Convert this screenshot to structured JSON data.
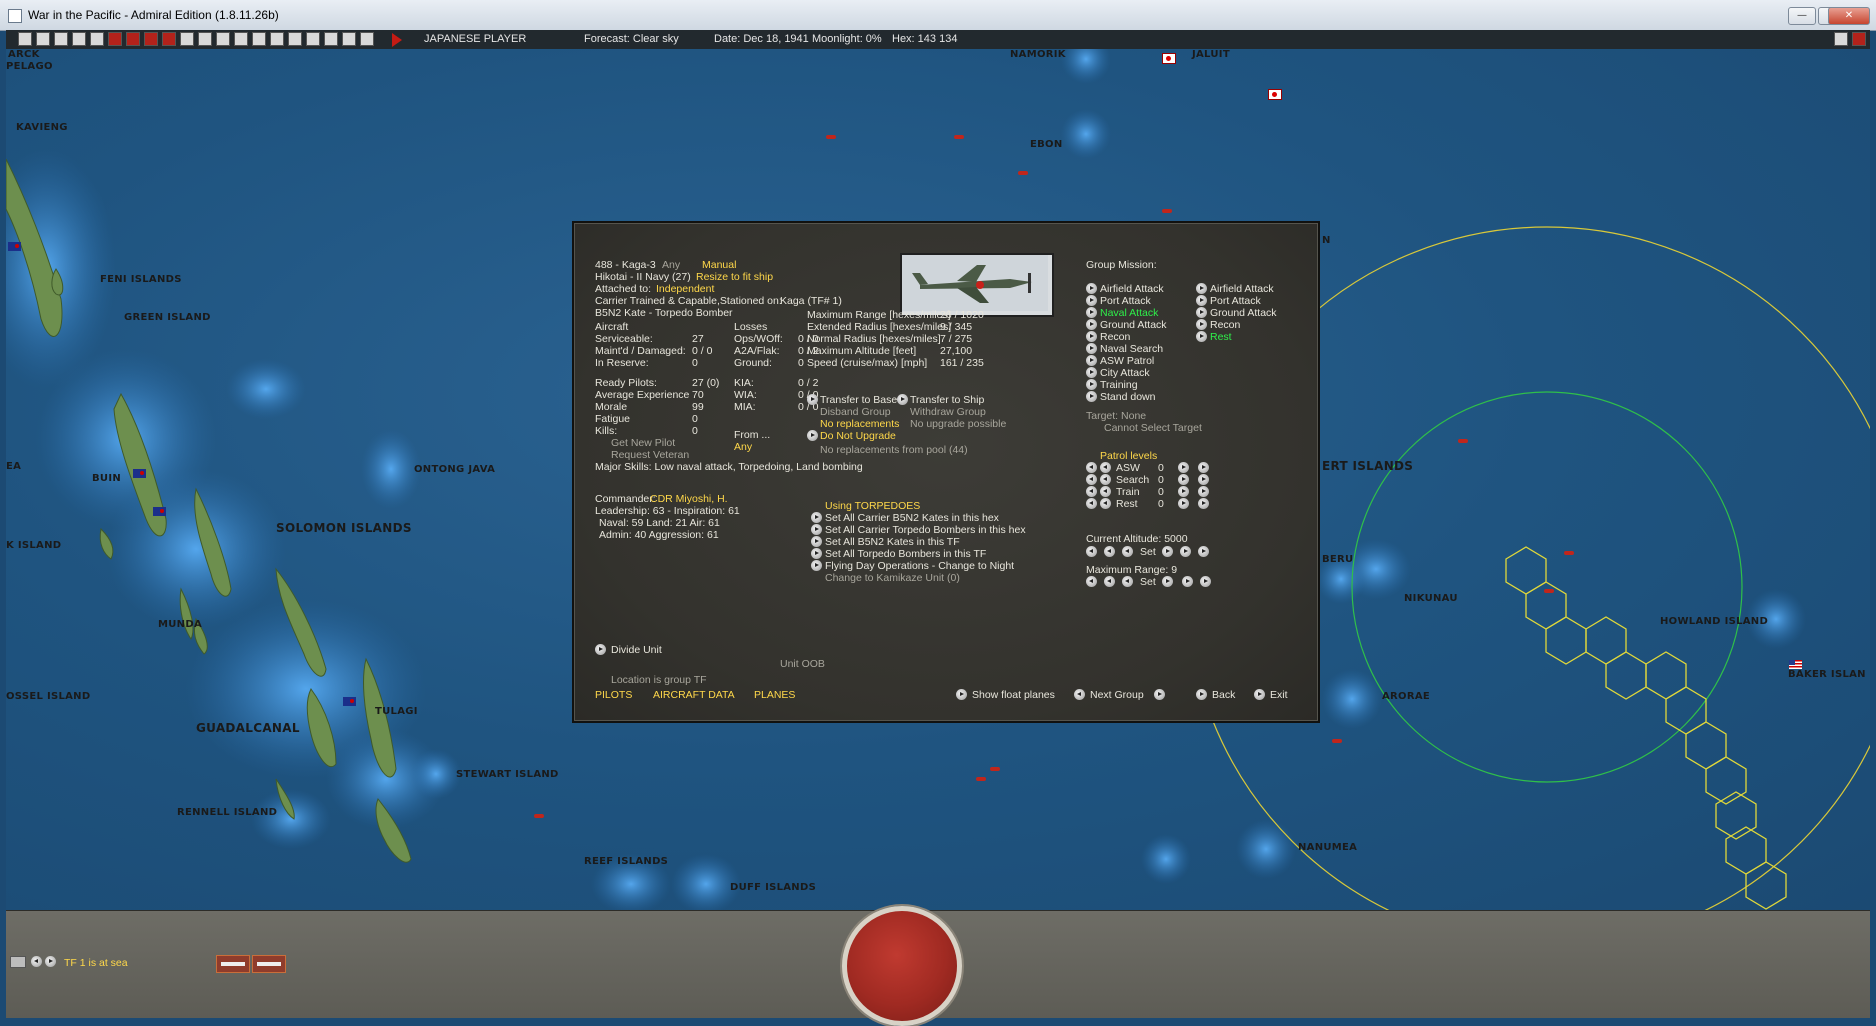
{
  "window": {
    "title": "War in the Pacific - Admiral Edition (1.8.11.26b)",
    "minimize": "—",
    "maximize": "▢",
    "close": "✕"
  },
  "toolbar": {
    "player": "JAPANESE PLAYER",
    "forecast": "Forecast: Clear sky",
    "date": "Date: Dec 18, 1941",
    "moonlight": "Moonlight: 0%",
    "hex": "Hex: 143 134"
  },
  "map_labels": {
    "arck": "ARCK",
    "pelago": "PELAGO",
    "kavieng": "KAVIENG",
    "feni": "FENI ISLANDS",
    "green": "GREEN ISLAND",
    "buin": "BUIN",
    "ontong": "ONTONG JAVA",
    "solomon": "SOLOMON ISLANDS",
    "munda": "MUNDA",
    "guadalcanal": "GUADALCANAL",
    "tulagi": "TULAGI",
    "stewart": "STEWART ISLAND",
    "rennell": "RENNELL ISLAND",
    "reef": "REEF ISLANDS",
    "duff": "DUFF ISLANDS",
    "ossel": "OSSEL ISLAND",
    "k_island": "K ISLAND",
    "ea": "EA",
    "namorik": "NAMORIK",
    "jaluit": "JALUIT",
    "ebon": "EBON",
    "n_edge": "N",
    "gilbert": "ERT ISLANDS",
    "beru": "BERU",
    "nikunau": "NIKUNAU",
    "howland": "HOWLAND ISLAND",
    "baker": "BAKER ISLAN",
    "arorae": "ARORAE",
    "nanumea": "NANUMEA"
  },
  "unit": {
    "line1": "488 - Kaga-3",
    "any_tag": "Any",
    "manual": "Manual",
    "line2": "Hikotai - II Navy (27)",
    "resize": "Resize to fit ship",
    "attached_label": "Attached to:",
    "attached_value": "Independent",
    "line4": "Carrier Trained & Capable,Stationed on:",
    "station": "Kaga (TF# 1)",
    "aircraft_type": "B5N2 Kate - Torpedo Bomber",
    "aircraft_header": "Aircraft",
    "serviceable_label": "Serviceable:",
    "serviceable": "27",
    "maint_label": "Maint'd / Damaged:",
    "maint": "0 / 0",
    "reserve_label": "In Reserve:",
    "reserve": "0",
    "losses_header": "Losses",
    "ops_label": "Ops/WOff:",
    "ops": "0 / 0",
    "a2a_label": "A2A/Flak:",
    "a2a": "0 / 2",
    "ground_label": "Ground:",
    "ground": "0",
    "ready_label": "Ready Pilots:",
    "ready": "27 (0)",
    "exp_label": "Average Experience",
    "exp": "70",
    "morale_label": "Morale",
    "morale": "99",
    "fatigue_label": "Fatigue",
    "fatigue": "0",
    "kills_label": "Kills:",
    "kills": "0",
    "kia_label": "KIA:",
    "kia": "0 / 2",
    "wia_label": "WIA:",
    "wia": "0 / 0",
    "mia_label": "MIA:",
    "mia": "0 / 0",
    "get_pilot": "Get New Pilot",
    "from_label": "From ...",
    "from_value": "Any",
    "req_veteran": "Request Veteran",
    "skills": "Major Skills: Low naval attack, Torpedoing, Land bombing",
    "commander_label": "Commander:",
    "commander": "CDR Miyoshi, H.",
    "leadership": "Leadership: 63 - Inspiration: 61",
    "naval": "Naval: 59  Land: 21  Air: 61",
    "admin": "Admin: 40  Aggression: 61"
  },
  "ranges": {
    "max_label": "Maximum Range [hexes/miles]",
    "max": "26 / 1020",
    "ext_label": "Extended Radius [hexes/miles]",
    "ext": "9 / 345",
    "norm_label": "Normal Radius [hexes/miles]",
    "norm": "7 / 275",
    "alt_label": "Maximum Altitude [feet]",
    "alt": "27,100",
    "speed_label": "Speed (cruise/max) [mph]",
    "speed": "161 / 235"
  },
  "transfer": {
    "to_base": "Transfer to Base",
    "to_ship": "Transfer to Ship",
    "disband": "Disband Group",
    "withdraw": "Withdraw Group",
    "no_repl": "No replacements",
    "no_upgrade_possible": "No upgrade possible",
    "do_not_upgrade": "Do Not Upgrade",
    "pool": "No replacements from pool (44)"
  },
  "torpedoes": {
    "header": "Using TORPEDOES",
    "items": [
      "Set All Carrier B5N2 Kates in this hex",
      "Set All Carrier Torpedo Bombers in this hex",
      "Set All B5N2 Kates in this TF",
      "Set All Torpedo Bombers in this TF",
      "Flying Day Operations - Change to Night"
    ],
    "kamikaze": "Change to Kamikaze Unit (0)"
  },
  "mission": {
    "header": "Group Mission:",
    "col1": [
      "Airfield Attack",
      "Port Attack",
      "Naval Attack",
      "Ground Attack",
      "Recon",
      "Naval Search",
      "ASW Patrol",
      "City Attack",
      "Training",
      "Stand down"
    ],
    "col2": [
      "Airfield Attack",
      "Port Attack",
      "Ground Attack",
      "Recon",
      "Rest"
    ],
    "target": "Target: None",
    "cannot": "Cannot Select Target"
  },
  "patrol": {
    "header": "Patrol levels",
    "rows": [
      {
        "label": "ASW",
        "value": "0"
      },
      {
        "label": "Search",
        "value": "0"
      },
      {
        "label": "Train",
        "value": "0"
      },
      {
        "label": "Rest",
        "value": "0"
      }
    ]
  },
  "altitude": {
    "label": "Current Altitude: 5000",
    "set": "Set"
  },
  "maxrange": {
    "label": "Maximum Range: 9",
    "set": "Set"
  },
  "divide": "Divide Unit",
  "unit_oob": "Unit OOB",
  "location": "Location is group TF",
  "tabs": {
    "pilots": "PILOTS",
    "aircraft": "AIRCRAFT DATA",
    "planes": "PLANES"
  },
  "nav": {
    "show_float": "Show float planes",
    "next_group": "Next Group",
    "back": "Back",
    "exit": "Exit"
  },
  "status": {
    "tf": "TF 1 is at sea"
  }
}
